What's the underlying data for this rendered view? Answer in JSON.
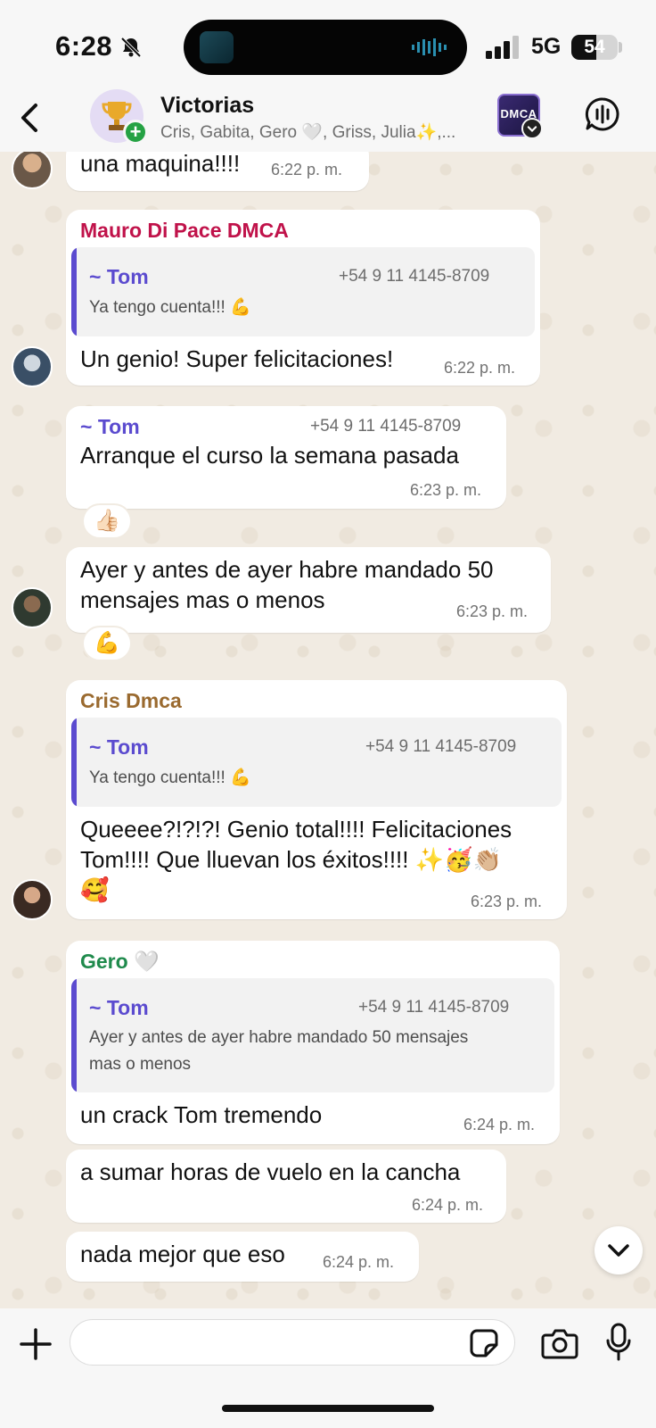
{
  "status_bar": {
    "time": "6:28",
    "network": "5G",
    "battery": "54",
    "battery_level": 0.54
  },
  "header": {
    "group_name": "Victorias",
    "members": "Cris, Gabita, Gero 🤍, Griss, Julia✨,...",
    "badge_text": "DMCA"
  },
  "messages": [
    {
      "text": "una maquina!!!!",
      "time": "6:22 p. m."
    },
    {
      "sender": "Mauro Di Pace DMCA",
      "quote": {
        "author": "~ Tom",
        "phone": "+54 9 11 4145-8709",
        "text": "Ya tengo cuenta!!! 💪"
      },
      "text": "Un genio! Super felicitaciones!",
      "time": "6:22 p. m."
    },
    {
      "header_author": "~ Tom",
      "header_phone": "+54 9 11 4145-8709",
      "text": "Arranque el curso la semana pasada",
      "time": "6:23 p. m.",
      "reaction": "👍🏻"
    },
    {
      "text_line1": "Ayer y antes de ayer habre mandado 50",
      "text_line2": "mensajes mas o menos",
      "time": "6:23 p. m.",
      "reaction": "💪"
    },
    {
      "sender": "Cris Dmca",
      "quote": {
        "author": "~ Tom",
        "phone": "+54 9 11 4145-8709",
        "text": "Ya tengo cuenta!!! 💪"
      },
      "text_line1": "Queeee?!?!?! Genio total!!!! Felicitaciones",
      "text_line2": "Tom!!!! Que lluevan los éxitos!!!! ✨🥳👏🏼",
      "text_line3": "🥰",
      "time": "6:23 p. m."
    },
    {
      "sender": "Gero 🤍",
      "quote": {
        "author": "~ Tom",
        "phone": "+54 9 11 4145-8709",
        "text_line1": "Ayer y antes de ayer habre mandado 50 mensajes",
        "text_line2": "mas o menos"
      },
      "text": "un crack Tom tremendo",
      "time": "6:24 p. m."
    },
    {
      "text": "a sumar horas de vuelo en la cancha",
      "time": "6:24 p. m."
    },
    {
      "text": "nada mejor que eso",
      "time": "6:24 p. m."
    }
  ],
  "colors": {
    "mauro": "#c0124a",
    "cris": "#9a6a2f",
    "gero": "#1f8a4c",
    "quote_accent": "#5b4bcf"
  },
  "input": {
    "placeholder": ""
  }
}
